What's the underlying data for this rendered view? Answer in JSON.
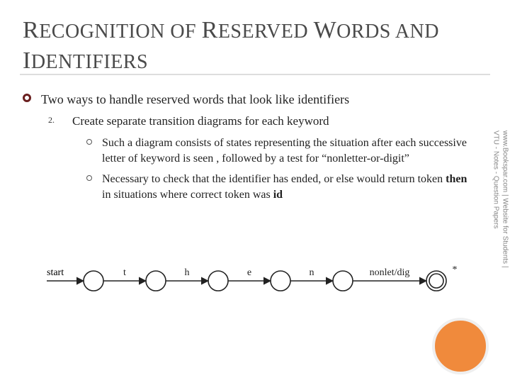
{
  "title_html": "<span class='big'>R</span>ECOGNITION OF <span class='big'>R</span>ESERVED <span class='big'>W</span>ORDS AND <span class='big'>I</span>DENTIFIERS",
  "bullets": {
    "lvl1": "Two ways to handle reserved words that look like identifiers",
    "lvl2_num": "2.",
    "lvl2": "Create separate transition diagrams for each keyword",
    "lvl3a": "Such a diagram consists of states representing the situation after each successive letter of keyword is seen , followed by a test for “nonletter-or-digit”",
    "lvl3b_prefix": "Necessary to check that the identifier has ended, or else would return token ",
    "lvl3b_bold1": "then",
    "lvl3b_mid": " in situations where correct token was ",
    "lvl3b_bold2": "id"
  },
  "watermark": {
    "line1": "www.Bookspar.com | Website for Students |",
    "line2": "VTU - Notes - Question Papers"
  },
  "diagram": {
    "start_label": "start",
    "edges": [
      "t",
      "h",
      "e",
      "n",
      "nonlet/dig"
    ],
    "retract_mark": "*"
  },
  "chart_data": {
    "type": "diagram",
    "description": "Finite-state transition diagram for keyword 'then'",
    "states": 6,
    "start_state_index": 0,
    "accepting_state_index": 5,
    "accepting_retract": true,
    "transitions": [
      {
        "from": 0,
        "to": 1,
        "label": "t"
      },
      {
        "from": 1,
        "to": 2,
        "label": "h"
      },
      {
        "from": 2,
        "to": 3,
        "label": "e"
      },
      {
        "from": 3,
        "to": 4,
        "label": "n"
      },
      {
        "from": 4,
        "to": 5,
        "label": "nonlet/dig"
      }
    ]
  }
}
